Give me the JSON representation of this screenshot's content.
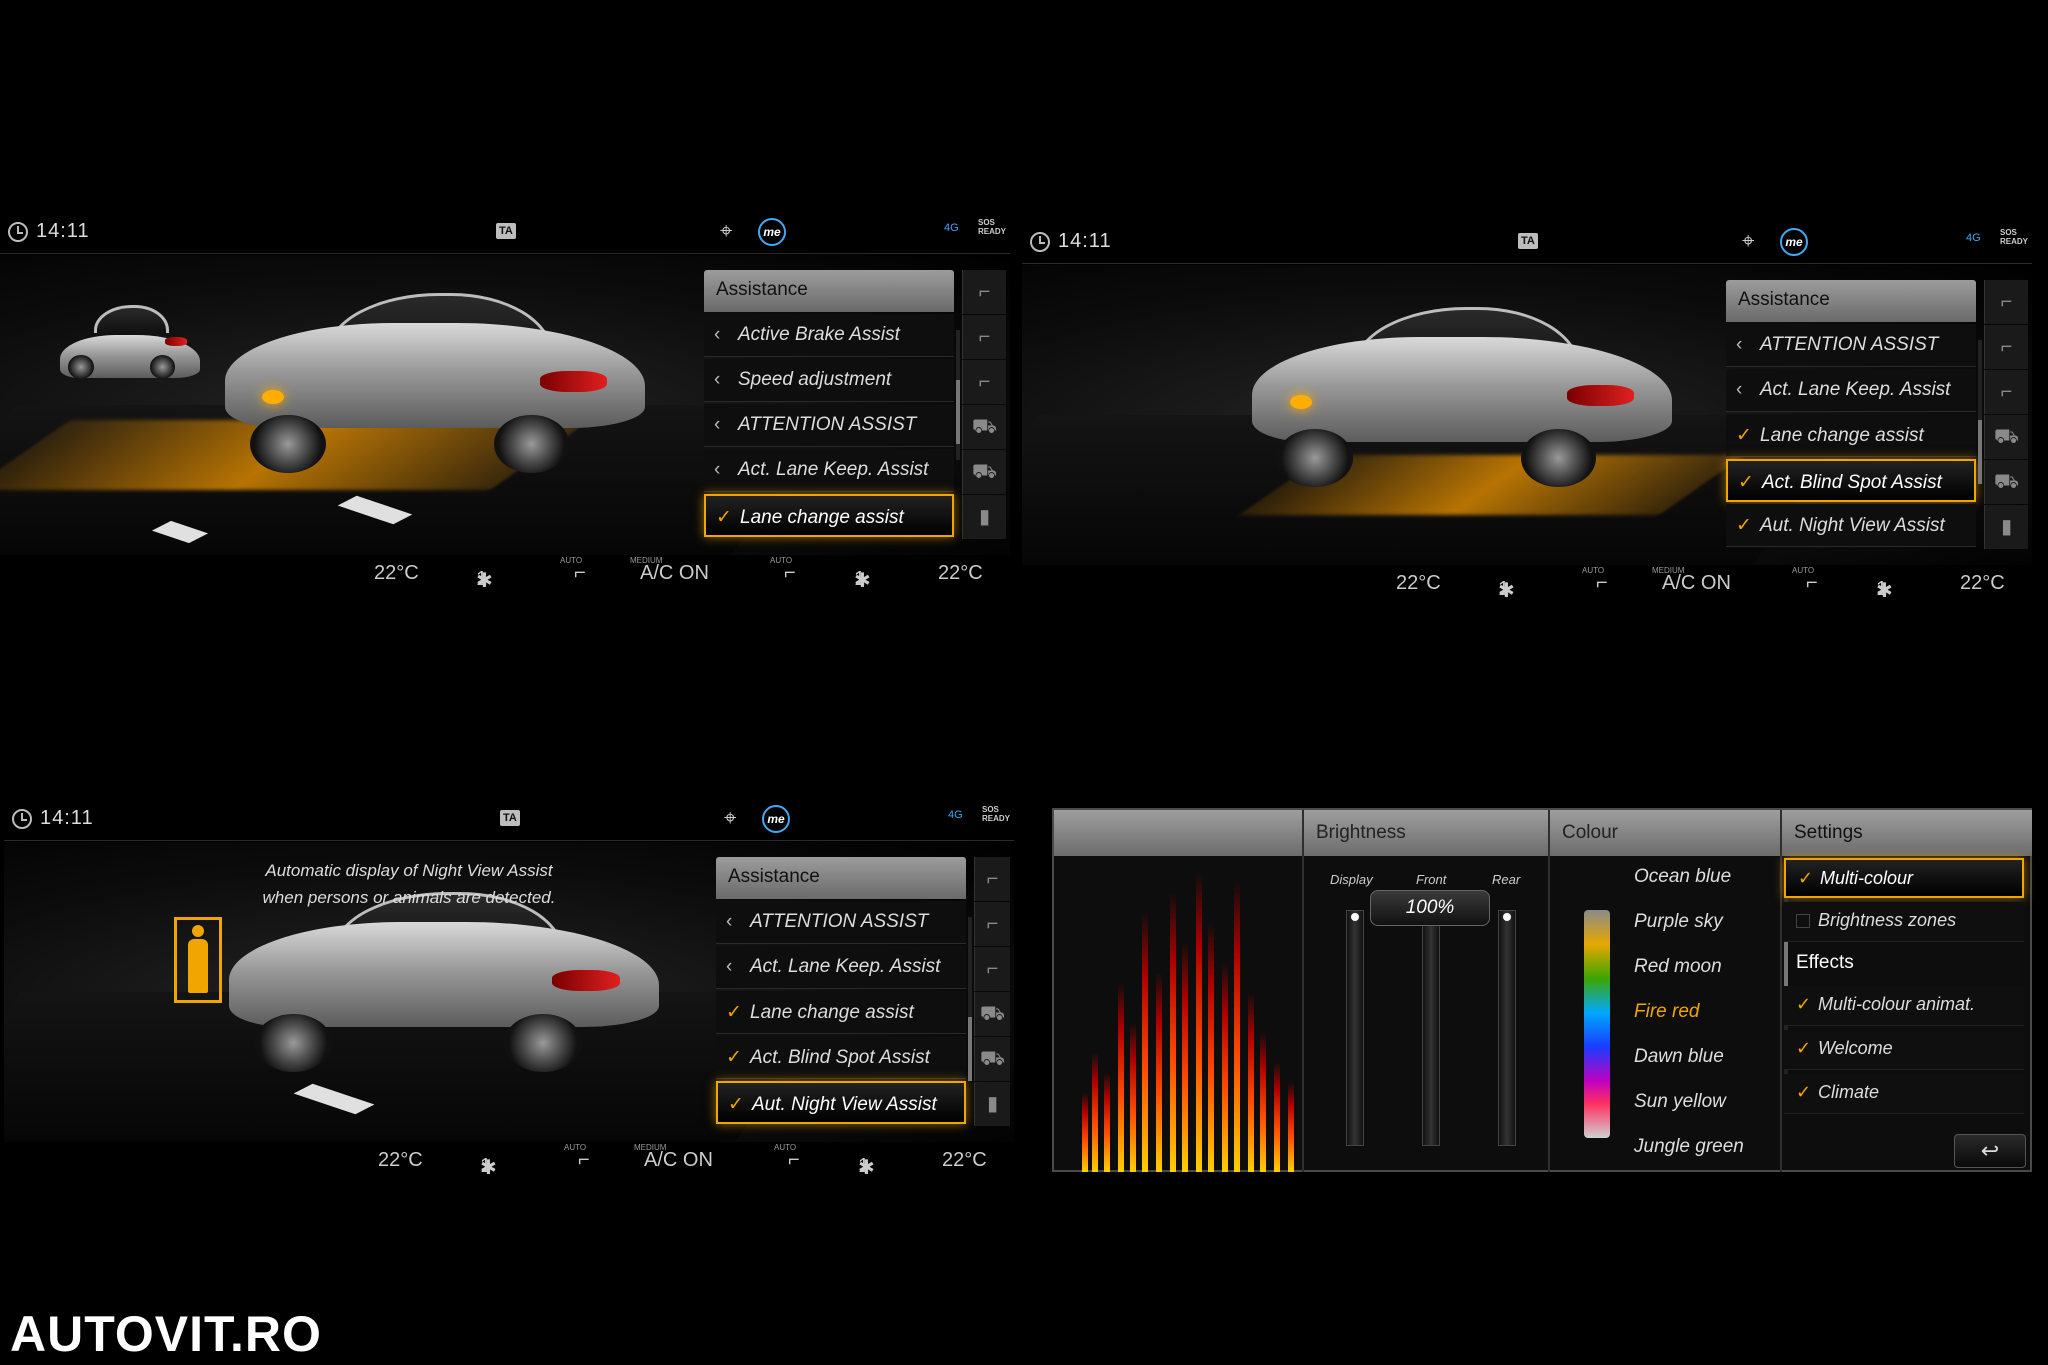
{
  "status": {
    "time": "14:11",
    "ta": "TA",
    "me": "me",
    "net": "4G",
    "sos": "SOS",
    "sos2": "READY"
  },
  "screen1": {
    "menu_title": "Assistance",
    "items": [
      {
        "label": "Active Brake Assist",
        "mark": "‹"
      },
      {
        "label": "Speed adjustment",
        "mark": "‹"
      },
      {
        "label": "ATTENTION ASSIST",
        "mark": "‹"
      },
      {
        "label": "Act. Lane Keep. Assist",
        "mark": "‹"
      },
      {
        "label": "Lane change assist",
        "mark": "✓"
      }
    ]
  },
  "screen2": {
    "menu_title": "Assistance",
    "items": [
      {
        "label": "ATTENTION ASSIST",
        "mark": "‹"
      },
      {
        "label": "Act. Lane Keep. Assist",
        "mark": "‹"
      },
      {
        "label": "Lane change assist",
        "mark": "✓"
      },
      {
        "label": "Act. Blind Spot Assist",
        "mark": "✓"
      },
      {
        "label": "Aut. Night View Assist",
        "mark": "✓"
      }
    ]
  },
  "screen3": {
    "menu_title": "Assistance",
    "note_line1": "Automatic display of Night View Assist",
    "note_line2": "when persons or animals are detected.",
    "items": [
      {
        "label": "ATTENTION ASSIST",
        "mark": "‹"
      },
      {
        "label": "Act. Lane Keep. Assist",
        "mark": "‹"
      },
      {
        "label": "Lane change assist",
        "mark": "✓"
      },
      {
        "label": "Act. Blind Spot Assist",
        "mark": "✓"
      },
      {
        "label": "Aut. Night View Assist",
        "mark": "✓"
      }
    ]
  },
  "climate": {
    "left_temp": "22°C",
    "fan_left": "1",
    "auto": "AUTO",
    "medium": "MEDIUM",
    "ac": "A/C ON",
    "fan_right": "1",
    "right_temp": "22°C"
  },
  "ambient": {
    "brightness_title": "Brightness",
    "colour_title": "Colour",
    "settings_title": "Settings",
    "slider_labels": [
      "Display",
      "Front",
      "Rear"
    ],
    "brightness_value": "100%",
    "brightness_level": 1.0,
    "colours": [
      "Ocean blue",
      "Purple sky",
      "Red moon",
      "Fire red",
      "Dawn blue",
      "Sun yellow",
      "Jungle green"
    ],
    "selected_colour": "Fire red",
    "settings": [
      {
        "label": "Multi-colour",
        "checked": true
      },
      {
        "label": "Brightness zones",
        "checked": false
      }
    ],
    "effects_title": "Effects",
    "effects": [
      {
        "label": "Multi-colour animat.",
        "checked": true
      },
      {
        "label": "Welcome",
        "checked": true
      },
      {
        "label": "Climate",
        "checked": true
      }
    ],
    "back_icon": "return-arrow-icon"
  },
  "watermark": "AUTOVIT.RO",
  "colors": {
    "accent": "#f0a500",
    "me_ring": "#3fa9f5"
  }
}
